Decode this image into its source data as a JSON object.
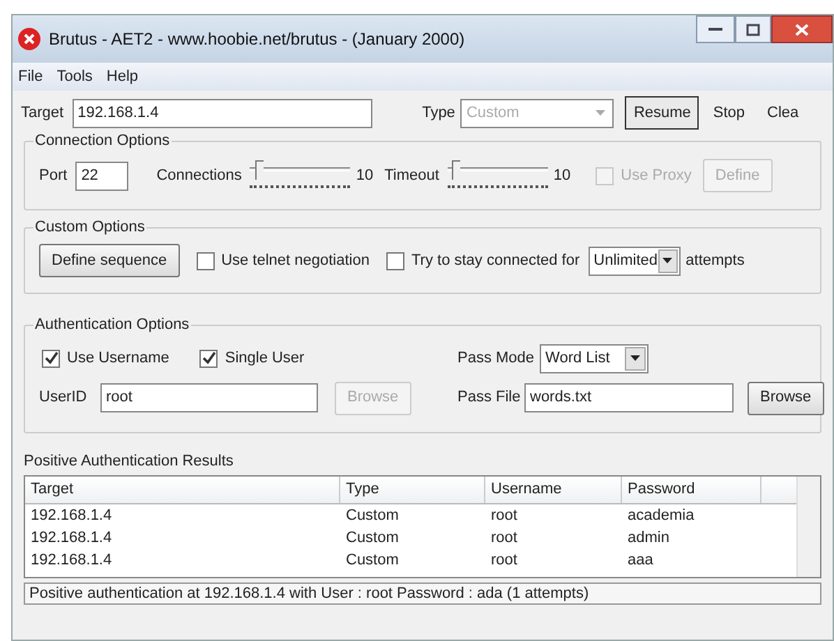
{
  "window": {
    "title": "Brutus - AET2 - www.hoobie.net/brutus - (January 2000)"
  },
  "menu": [
    "File",
    "Tools",
    "Help"
  ],
  "target": {
    "label": "Target",
    "value": "192.168.1.4"
  },
  "type": {
    "label": "Type",
    "value": "Custom",
    "disabled": true
  },
  "actions": [
    {
      "label": "Resume",
      "default": true
    },
    {
      "label": "Stop",
      "default": false
    },
    {
      "label": "Clea",
      "default": false
    }
  ],
  "connection_options": {
    "title": "Connection Options",
    "port": {
      "label": "Port",
      "value": "22"
    },
    "sliders": [
      {
        "label": "Connections",
        "level": 0.05,
        "max": "10"
      },
      {
        "label": "Timeout",
        "level": 0.05,
        "max": "10"
      }
    ],
    "use_proxy": {
      "label": "Use Proxy",
      "checked": false,
      "disabled": true
    },
    "define": {
      "label": "Define",
      "disabled": true
    }
  },
  "custom_options": {
    "title": "Custom Options",
    "define_sequence": "Define sequence",
    "checks": [
      {
        "label": "Use telnet negotiation",
        "checked": false
      },
      {
        "label": "Try to stay connected for",
        "checked": false
      }
    ],
    "attempts": {
      "value": "Unlimited",
      "suffix": "attempts"
    }
  },
  "authentication_options": {
    "title": "Authentication Options",
    "checks": [
      {
        "label": "Use Username",
        "checked": true
      },
      {
        "label": "Single User",
        "checked": true
      }
    ],
    "userid": {
      "label": "UserID",
      "value": "root",
      "browse": "Browse",
      "browse_disabled": true
    },
    "pass_mode": {
      "label": "Pass Mode",
      "value": "Word List"
    },
    "pass_file": {
      "label": "Pass File",
      "value": "words.txt",
      "browse": "Browse",
      "browse_disabled": false
    }
  },
  "results": {
    "title": "Positive Authentication Results",
    "columns": [
      "Target",
      "Type",
      "Username",
      "Password"
    ],
    "rows": [
      [
        "192.168.1.4",
        "Custom",
        "root",
        "academia"
      ],
      [
        "192.168.1.4",
        "Custom",
        "root",
        "admin"
      ],
      [
        "192.168.1.4",
        "Custom",
        "root",
        "aaa"
      ]
    ]
  },
  "status_bar": "Positive authentication at 192.168.1.4 with User : root  Password : ada (1 attempts)"
}
